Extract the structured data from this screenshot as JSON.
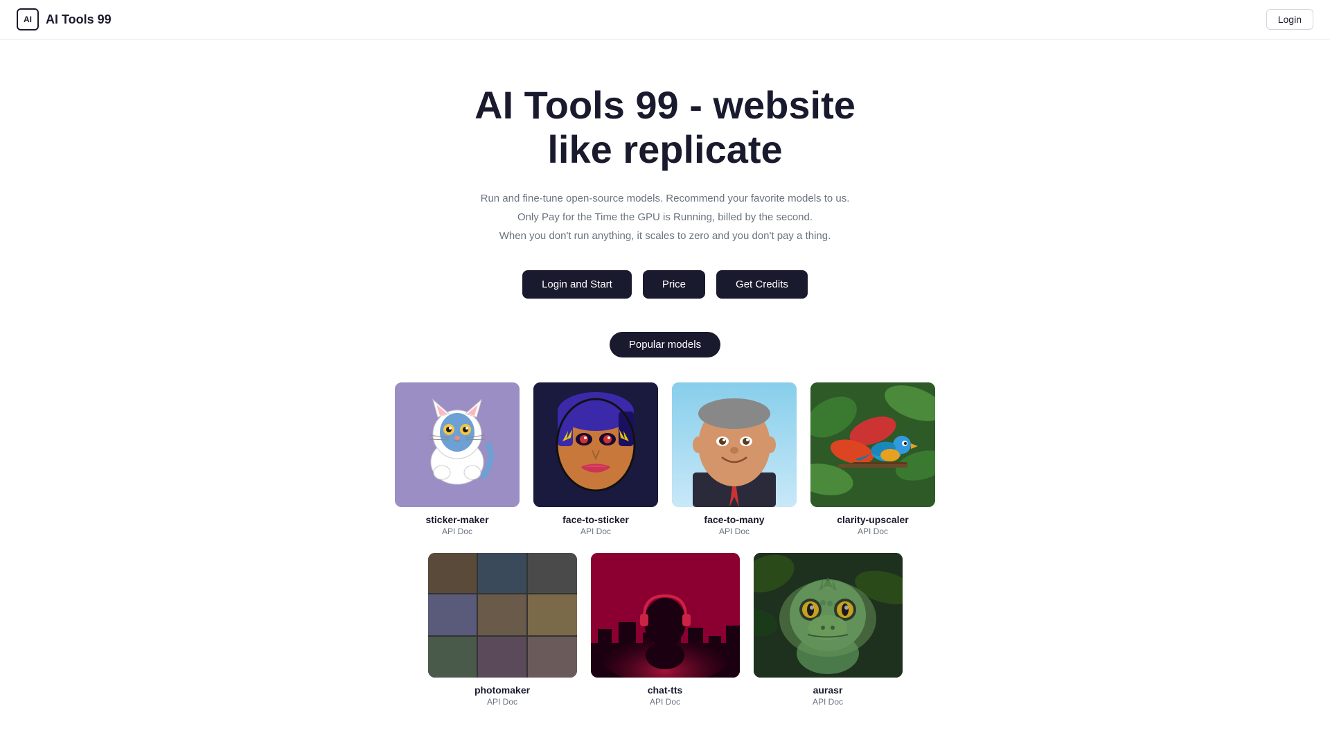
{
  "navbar": {
    "logo_text": "AI",
    "brand_name": "AI Tools 99",
    "login_label": "Login"
  },
  "hero": {
    "title_line1": "AI Tools 99 - website",
    "title_line2": "like replicate",
    "subtitle_line1": "Run and fine-tune open-source models. Recommend your favorite models to us.",
    "subtitle_line2": "Only Pay for the Time the GPU is Running, billed by the second.",
    "subtitle_line3": "When you don't run anything, it scales to zero and you don't pay a thing."
  },
  "cta_buttons": {
    "login_start": "Login and Start",
    "price": "Price",
    "get_credits": "Get Credits"
  },
  "popular_models_label": "Popular models",
  "models_row1": [
    {
      "name": "sticker-maker",
      "api_label": "API Doc",
      "emoji": "🐱",
      "style": "sticker-maker"
    },
    {
      "name": "face-to-sticker",
      "api_label": "API Doc",
      "emoji": "🎭",
      "style": "face-sticker"
    },
    {
      "name": "face-to-many",
      "api_label": "API Doc",
      "emoji": "👤",
      "style": "face-many"
    },
    {
      "name": "clarity-upscaler",
      "api_label": "API Doc",
      "emoji": "🦜",
      "style": "clarity"
    }
  ],
  "models_row2": [
    {
      "name": "photomaker",
      "api_label": "API Doc",
      "style": "photomaker"
    },
    {
      "name": "chat-tts",
      "api_label": "API Doc",
      "emoji": "🎧",
      "style": "chat-tts"
    },
    {
      "name": "aurasr",
      "api_label": "API Doc",
      "emoji": "🦎",
      "style": "aurasr"
    }
  ]
}
